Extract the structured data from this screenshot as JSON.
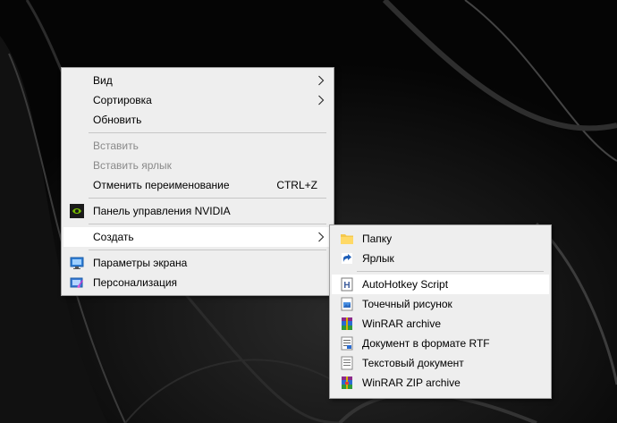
{
  "context_menu": {
    "items": [
      {
        "label": "Вид"
      },
      {
        "label": "Сортировка"
      },
      {
        "label": "Обновить"
      },
      {
        "label": "Вставить"
      },
      {
        "label": "Вставить ярлык"
      },
      {
        "label": "Отменить переименование",
        "shortcut": "CTRL+Z"
      },
      {
        "label": "Панель управления NVIDIA"
      },
      {
        "label": "Создать"
      },
      {
        "label": "Параметры экрана"
      },
      {
        "label": "Персонализация"
      }
    ]
  },
  "submenu_create": {
    "items": [
      {
        "label": "Папку"
      },
      {
        "label": "Ярлык"
      },
      {
        "label": "AutoHotkey Script"
      },
      {
        "label": "Точечный рисунок"
      },
      {
        "label": "WinRAR archive"
      },
      {
        "label": "Документ в формате RTF"
      },
      {
        "label": "Текстовый документ"
      },
      {
        "label": "WinRAR ZIP archive"
      }
    ]
  },
  "colors": {
    "menu_bg": "#eeeeee",
    "hover_bg": "#ffffff",
    "disabled_text": "#8a8a8a",
    "nvidia_green": "#76b900"
  },
  "icons": {
    "nvidia": "nvidia-icon",
    "display": "display-settings-icon",
    "personalize": "personalization-icon",
    "folder": "folder-icon",
    "shortcut": "shortcut-icon",
    "ahk": "autohotkey-icon",
    "bitmap": "bitmap-icon",
    "winrar": "winrar-icon",
    "rtf": "rtf-document-icon",
    "text": "text-document-icon",
    "winrar_zip": "winrar-zip-icon"
  }
}
